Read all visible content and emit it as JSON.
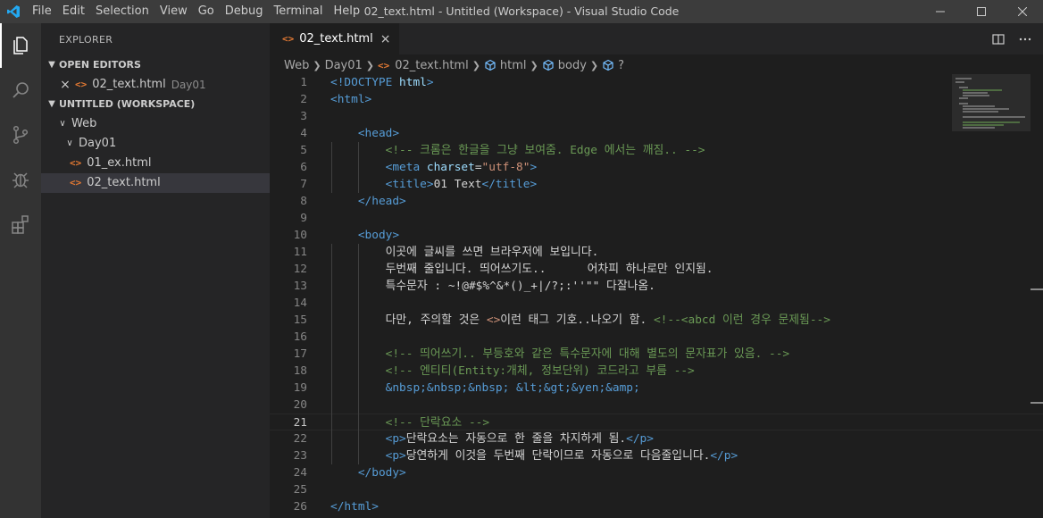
{
  "window": {
    "title": "02_text.html - Untitled (Workspace) - Visual Studio Code",
    "menu": [
      "File",
      "Edit",
      "Selection",
      "View",
      "Go",
      "Debug",
      "Terminal",
      "Help"
    ]
  },
  "colors": {
    "accent": "#007acc",
    "tag": "#569cd6",
    "attr": "#9cdcfe",
    "string": "#ce9178",
    "comment": "#6a9955",
    "text": "#d4d4d4",
    "file_icon": "#e37933"
  },
  "activity_icons": [
    "files-icon",
    "search-icon",
    "source-control-icon",
    "debug-icon",
    "extensions-icon"
  ],
  "sidebar": {
    "title": "EXPLORER",
    "open_editors_label": "OPEN EDITORS",
    "open_editors": [
      {
        "name": "02_text.html",
        "folder": "Day01"
      }
    ],
    "workspace_label": "UNTITLED (WORKSPACE)",
    "tree": [
      {
        "label": "Web",
        "kind": "folder"
      },
      {
        "label": "Day01",
        "kind": "folder"
      },
      {
        "label": "01_ex.html",
        "kind": "file"
      },
      {
        "label": "02_text.html",
        "kind": "file"
      }
    ]
  },
  "editor": {
    "tab_label": "02_text.html",
    "breadcrumb": [
      "Web",
      "Day01",
      "02_text.html",
      "html",
      "body",
      "?"
    ],
    "current_line": 21,
    "lines": [
      [
        {
          "t": "<!DOCTYPE ",
          "c": "tag"
        },
        {
          "t": "html",
          "c": "attr"
        },
        {
          "t": ">",
          "c": "tag"
        }
      ],
      [
        {
          "t": "<html>",
          "c": "tag"
        }
      ],
      [],
      [
        {
          "t": "    "
        },
        {
          "t": "<head>",
          "c": "tag"
        }
      ],
      [
        {
          "t": "        "
        },
        {
          "t": "<!-- 크롬은 한글을 그냥 보여줌. Edge 에서는 깨짐.. -->",
          "c": "comment"
        }
      ],
      [
        {
          "t": "        "
        },
        {
          "t": "<meta ",
          "c": "tag"
        },
        {
          "t": "charset",
          "c": "attr"
        },
        {
          "t": "=",
          "c": "text"
        },
        {
          "t": "\"utf-8\"",
          "c": "string"
        },
        {
          "t": ">",
          "c": "tag"
        }
      ],
      [
        {
          "t": "        "
        },
        {
          "t": "<title>",
          "c": "tag"
        },
        {
          "t": "01 Text",
          "c": "text"
        },
        {
          "t": "</title>",
          "c": "tag"
        }
      ],
      [
        {
          "t": "    "
        },
        {
          "t": "</head>",
          "c": "tag"
        }
      ],
      [],
      [
        {
          "t": "    "
        },
        {
          "t": "<body>",
          "c": "tag"
        }
      ],
      [
        {
          "t": "        이곳에 글씨를 쓰면 브라우저에 보입니다.",
          "c": "text"
        }
      ],
      [
        {
          "t": "        두번째 줄입니다. 띄어쓰기도..      어차피 하나로만 인지됨.",
          "c": "text"
        }
      ],
      [
        {
          "t": "        특수문자 : ~!@#$%^&*()_+|/?;:''\"\" 다잘나옴.",
          "c": "text"
        }
      ],
      [],
      [
        {
          "t": "        다만, 주의할 것은 ",
          "c": "text"
        },
        {
          "t": "<>",
          "c": "string"
        },
        {
          "t": "이런 태그 기호..나오기 함. ",
          "c": "text"
        },
        {
          "t": "<!--<abcd 이런 경우 문제됨-->",
          "c": "comment"
        }
      ],
      [],
      [
        {
          "t": "        "
        },
        {
          "t": "<!-- 띄어쓰기.. 부등호와 같은 특수문자에 대해 별도의 문자표가 있음. -->",
          "c": "comment"
        }
      ],
      [
        {
          "t": "        "
        },
        {
          "t": "<!-- 엔티티(Entity:개체, 정보단위) 코드라고 부름 -->",
          "c": "comment"
        }
      ],
      [
        {
          "t": "        "
        },
        {
          "t": "&nbsp;&nbsp;&nbsp; &lt;&gt;&yen;&amp;",
          "c": "tag"
        }
      ],
      [],
      [
        {
          "t": "        "
        },
        {
          "t": "<!-- 단락요소 -->",
          "c": "comment"
        }
      ],
      [
        {
          "t": "        "
        },
        {
          "t": "<p>",
          "c": "tag"
        },
        {
          "t": "단락요소는 자동으로 한 줄을 차지하게 됨.",
          "c": "text"
        },
        {
          "t": "</p>",
          "c": "tag"
        }
      ],
      [
        {
          "t": "        "
        },
        {
          "t": "<p>",
          "c": "tag"
        },
        {
          "t": "당연하게 이것을 두번째 단락이므로 자동으로 다음줄입니다.",
          "c": "text"
        },
        {
          "t": "</p>",
          "c": "tag"
        }
      ],
      [
        {
          "t": "    "
        },
        {
          "t": "</body>",
          "c": "tag"
        }
      ],
      [],
      [
        {
          "t": "</html>",
          "c": "tag"
        }
      ]
    ]
  }
}
